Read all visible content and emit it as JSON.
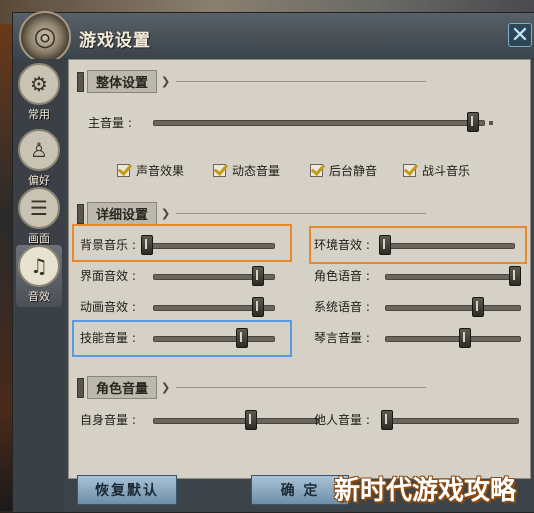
{
  "window": {
    "title": "游戏设置",
    "close_symbol": "✕"
  },
  "tabs": [
    {
      "label": "常用",
      "icon": "gear-icon",
      "glyph": "⚙"
    },
    {
      "label": "偏好",
      "icon": "figure-icon",
      "glyph": "♙"
    },
    {
      "label": "画面",
      "icon": "display-icon",
      "glyph": "☰"
    },
    {
      "label": "音效",
      "icon": "sound-icon",
      "glyph": "♫"
    }
  ],
  "sections": {
    "overall": {
      "title": "整体设置"
    },
    "detail": {
      "title": "详细设置"
    },
    "role": {
      "title": "角色音量"
    }
  },
  "master_volume": {
    "label": "主音量 :",
    "value": 0.98
  },
  "checkboxes": [
    {
      "label": "声音效果",
      "checked": true
    },
    {
      "label": "动态音量",
      "checked": true
    },
    {
      "label": "后台静音",
      "checked": true
    },
    {
      "label": "战斗音乐",
      "checked": true
    }
  ],
  "detail_sliders": {
    "bg_music": {
      "label": "背景音乐 :",
      "value": 0.0
    },
    "ambient": {
      "label": "环境音效 :",
      "value": 0.0
    },
    "ui_sound": {
      "label": "界面音效 :",
      "value": 0.9
    },
    "voice": {
      "label": "角色语音 :",
      "value": 1.0
    },
    "anim_sound": {
      "label": "动画音效 :",
      "value": 0.9
    },
    "system_voice": {
      "label": "系统语音 :",
      "value": 0.7
    },
    "skill_volume": {
      "label": "技能音量 :",
      "value": 0.75
    },
    "qin_volume": {
      "label": "琴言音量 :",
      "value": 0.6
    }
  },
  "role_sliders": {
    "self": {
      "label": "自身音量 :",
      "value": 0.6
    },
    "others": {
      "label": "他人音量 :",
      "value": 0.0
    }
  },
  "buttons": {
    "reset": "恢复默认",
    "confirm": "确 定"
  },
  "watermark": "新时代游戏攻略"
}
